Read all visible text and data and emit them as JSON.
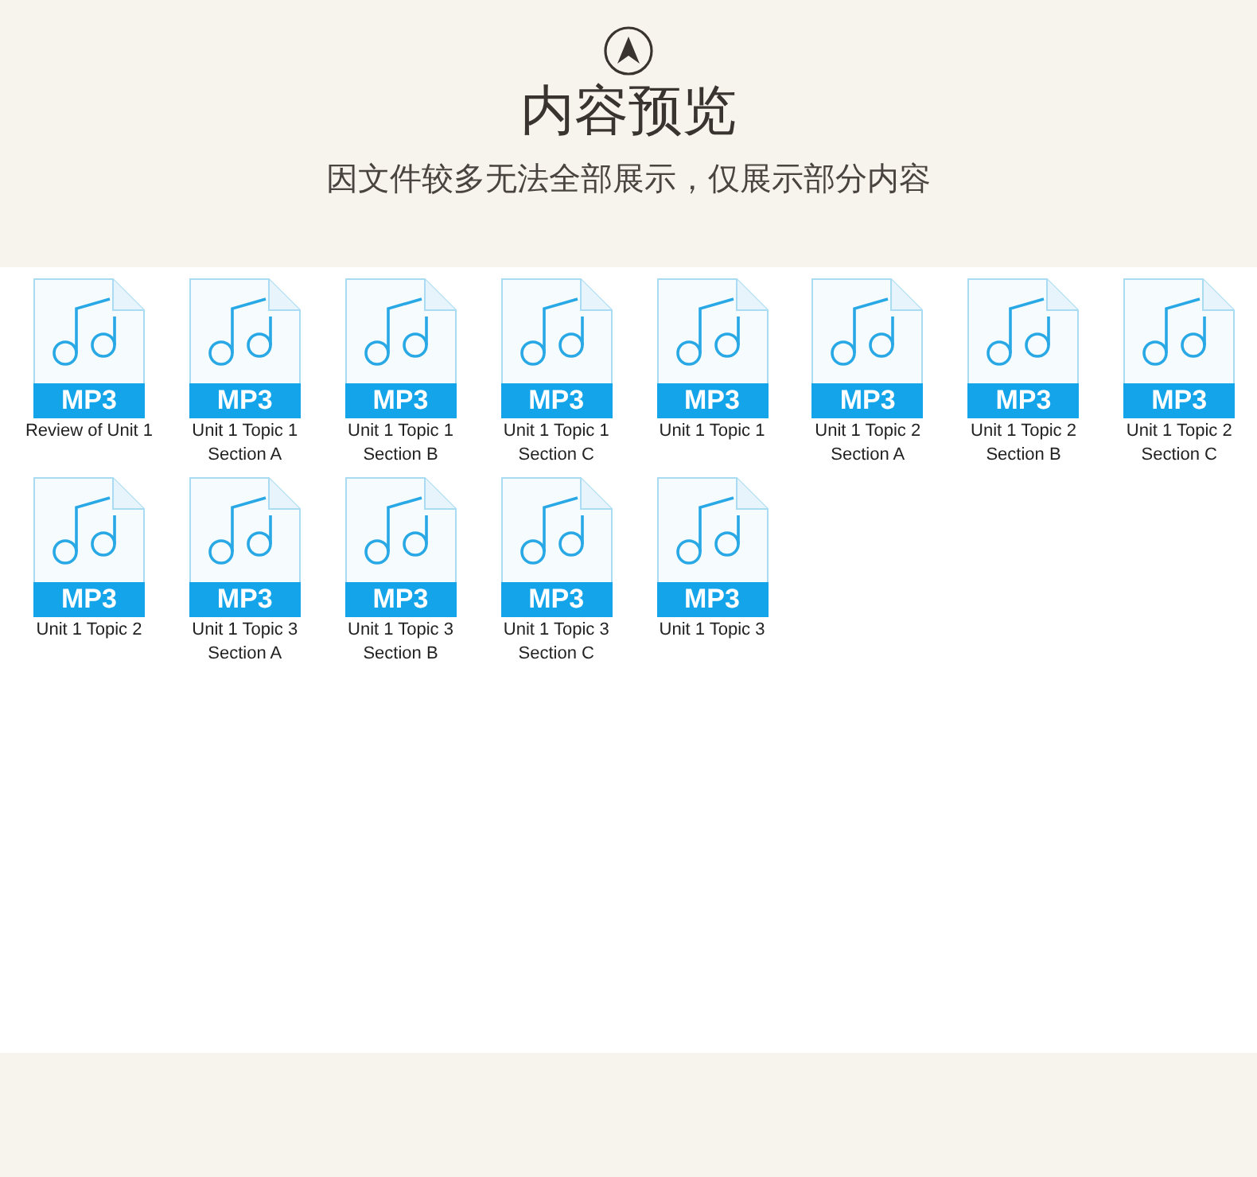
{
  "header": {
    "title": "内容预览",
    "subtitle": "因文件较多无法全部展示，仅展示部分内容"
  },
  "files": [
    {
      "name": "Review of Unit 1",
      "type": "MP3"
    },
    {
      "name": "Unit 1 Topic 1 Section A",
      "type": "MP3"
    },
    {
      "name": "Unit 1 Topic 1 Section B",
      "type": "MP3"
    },
    {
      "name": "Unit 1 Topic 1 Section C",
      "type": "MP3"
    },
    {
      "name": "Unit 1 Topic 1",
      "type": "MP3"
    },
    {
      "name": "Unit 1 Topic 2 Section A",
      "type": "MP3"
    },
    {
      "name": "Unit 1 Topic 2 Section B",
      "type": "MP3"
    },
    {
      "name": "Unit 1 Topic 2 Section C",
      "type": "MP3"
    },
    {
      "name": "Unit 1 Topic 2",
      "type": "MP3"
    },
    {
      "name": "Unit 1 Topic 3 Section A",
      "type": "MP3"
    },
    {
      "name": "Unit 1 Topic 3 Section B",
      "type": "MP3"
    },
    {
      "name": "Unit 1 Topic 3 Section C",
      "type": "MP3"
    },
    {
      "name": "Unit 1 Topic 3",
      "type": "MP3"
    }
  ]
}
